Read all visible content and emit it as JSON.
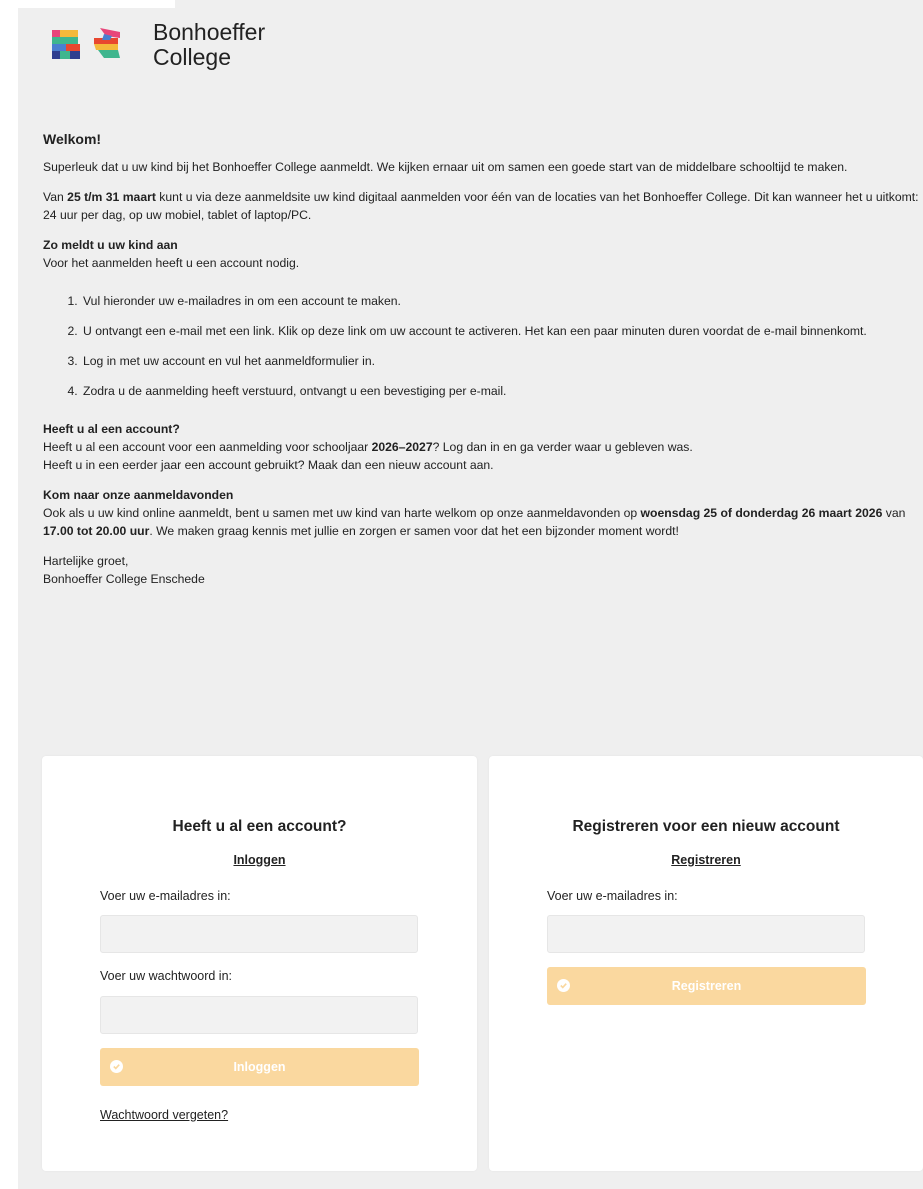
{
  "brand": {
    "line1": "Bonhoeffer",
    "line2": "College"
  },
  "intro": {
    "heading": "Welkom!",
    "p1": "Superleuk dat u uw kind bij het Bonhoeffer College aanmeldt. We kijken ernaar uit om samen een goede start van de middelbare schooltijd te maken.",
    "p2_a": "Van ",
    "p2_bold": "25 t/m 31 maart",
    "p2_b": " kunt u via deze aanmeldsite uw kind digitaal aanmelden voor één van de locaties van het Bonhoeffer College. Dit kan wanneer het u uitkomt: 24 uur per dag, op uw mobiel, tablet of laptop/PC.",
    "howto_title": "Zo meldt u uw kind aan",
    "howto_text": "Voor het aanmelden heeft u een account nodig.",
    "steps": [
      "Vul hieronder uw e-mailadres in om een account te maken.",
      "U ontvangt een e-mail met een link. Klik op deze link om uw account te activeren. Het kan een paar minuten duren voordat de e-mail binnenkomt.",
      "Log in met uw account en vul het aanmeldformulier in.",
      "Zodra u de aanmelding heeft verstuurd, ontvangt u een bevestiging per e-mail."
    ],
    "account_title": "Heeft u al een account?",
    "account_line1_a": "Heeft u al een account voor een aanmelding voor schooljaar ",
    "account_line1_bold": "2026–2027",
    "account_line1_b": "? Log dan in en ga verder waar u gebleven was.",
    "account_line2": "Heeft u in een eerder jaar een account gebruikt? Maak dan een nieuw account aan.",
    "evening_title": "Kom naar onze aanmeldavonden",
    "evening_a": "Ook als u uw kind online aanmeldt, bent u samen met uw kind van harte welkom op onze aanmeldavonden op ",
    "evening_bold1": "woensdag 25 of donderdag 26 maart 2026",
    "evening_b": " van ",
    "evening_bold2": "17.00 tot 20.00 uur",
    "evening_c": ". We maken graag kennis met jullie en zorgen er samen voor dat het een bijzonder moment wordt!",
    "closing1": "Hartelijke groet,",
    "closing2": "Bonhoeffer College Enschede"
  },
  "login_card": {
    "title": "Heeft u al een account?",
    "link": "Inloggen",
    "email_label": "Voer uw e-mailadres in:",
    "email_value": "",
    "password_label": "Voer uw wachtwoord in:",
    "password_value": "",
    "button": "Inloggen",
    "forgot": "Wachtwoord vergeten?"
  },
  "register_card": {
    "title": "Registreren voor een nieuw account",
    "link": "Registreren",
    "email_label": "Voer uw e-mailadres in:",
    "email_value": "",
    "button": "Registreren"
  },
  "colors": {
    "page_bg": "#efefef",
    "button_disabled": "#fad89f",
    "logo_green": "#3fb68e",
    "logo_pink": "#e8457a",
    "logo_blue": "#4a7fd0",
    "logo_yellow": "#f4b93b",
    "logo_red": "#e8472f"
  },
  "icons": {
    "button_icon": "check-circle-icon"
  }
}
